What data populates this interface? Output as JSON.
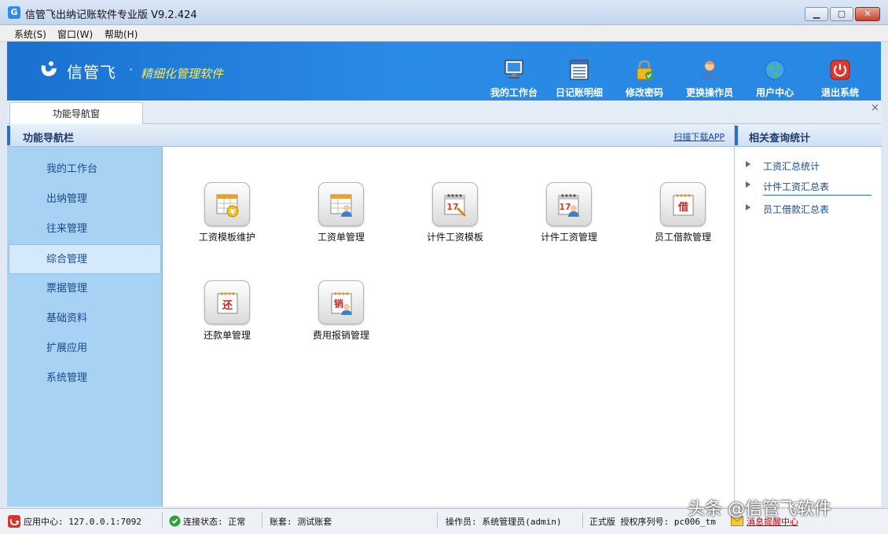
{
  "window": {
    "title": "信管飞出纳记账软件专业版 V9.2.424",
    "buttons": [
      "minimize",
      "maximize",
      "close"
    ]
  },
  "menu": [
    "系统(S)",
    "窗口(W)",
    "帮助(H)"
  ],
  "banner": {
    "brand": "信管飞",
    "dot": "·",
    "slogan": "精细化管理软件",
    "tools": [
      {
        "label": "我的工作台",
        "icon": "monitor-icon"
      },
      {
        "label": "日记账明细",
        "icon": "ledger-icon"
      },
      {
        "label": "修改密码",
        "icon": "lock-icon"
      },
      {
        "label": "更换操作员",
        "icon": "user-icon"
      },
      {
        "label": "用户中心",
        "icon": "globe-icon"
      },
      {
        "label": "退出系统",
        "icon": "power-icon"
      }
    ]
  },
  "tabs": {
    "active": "功能导航窗",
    "close": "×"
  },
  "leftnav": {
    "title": "功能导航栏",
    "items": [
      "我的工作台",
      "出纳管理",
      "往来管理",
      "综合管理",
      "票据管理",
      "基础资料",
      "扩展应用",
      "系统管理"
    ],
    "active_index": 3
  },
  "center": {
    "scan_link": "扫描下载APP",
    "functions": [
      {
        "label": "工资模板维护",
        "glyph": "¥",
        "icon": "salary-template-icon"
      },
      {
        "label": "工资单管理",
        "glyph": "",
        "icon": "payslip-icon"
      },
      {
        "label": "计件工资模板",
        "glyph": "17",
        "icon": "piecework-template-icon"
      },
      {
        "label": "计件工资管理",
        "glyph": "17",
        "icon": "piecework-manage-icon"
      },
      {
        "label": "员工借款管理",
        "glyph": "借",
        "icon": "employee-loan-icon"
      },
      {
        "label": "还款单管理",
        "glyph": "还",
        "icon": "repayment-icon"
      },
      {
        "label": "费用报销管理",
        "glyph": "销",
        "icon": "expense-icon"
      }
    ]
  },
  "rightpanel": {
    "title": "相关查询统计",
    "links": [
      "工资汇总统计",
      "计件工资汇总表",
      "员工借款汇总表"
    ]
  },
  "statusbar": {
    "app_center": "应用中心: 127.0.0.1:7092",
    "connection": "连接状态: 正常",
    "account": "账套: 测试账套",
    "operator": "操作员: 系统管理员(admin)",
    "license": "正式版 授权序列号: pc006_tm",
    "message": "消息提醒中心"
  },
  "watermark": "头条 @信管飞软件",
  "colors": {
    "banner": "#2787e2",
    "slogan": "#ffe94d",
    "nav_bg": "#a7d2f3",
    "link": "#1747b5"
  }
}
